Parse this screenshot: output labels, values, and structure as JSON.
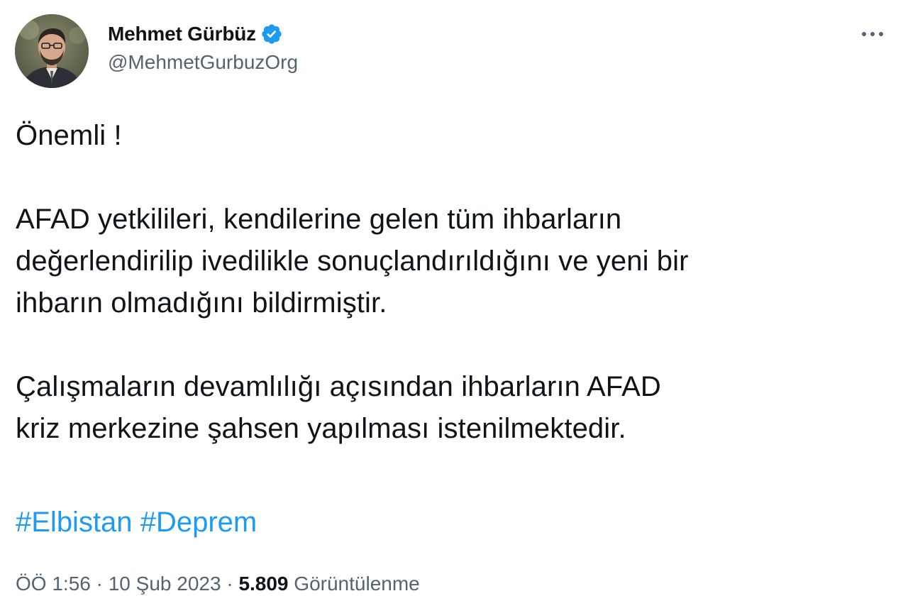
{
  "author": {
    "display_name": "Mehmet Gürbüz",
    "handle": "@MehmetGurbuzOrg",
    "verified": true,
    "avatar": "profile-photo"
  },
  "tweet": {
    "headline": "Önemli !",
    "paragraph_1": [
      "AFAD yetkilileri, kendilerine gelen tüm ihbarların",
      "değerlendirilip ivedilikle sonuçlandırıldığını ve yeni bir",
      "ihbarın olmadığını bildirmiştir."
    ],
    "paragraph_2": [
      "Çalışmaların devamlılığı açısından ihbarların AFAD",
      "kriz merkezine şahsen yapılması istenilmektedir."
    ],
    "hashtags": [
      "#Elbistan",
      "#Deprem"
    ]
  },
  "meta": {
    "time": "ÖÖ 1:56",
    "separator": "·",
    "date": "10 Şub 2023",
    "views_count": "5.809",
    "views_label": "Görüntülenme"
  },
  "icons": {
    "more": "more-horizontal-icon",
    "verified": "verified-badge-icon"
  },
  "colors": {
    "link": "#1d9bf0",
    "text": "#0f1419",
    "secondary": "#536471"
  }
}
